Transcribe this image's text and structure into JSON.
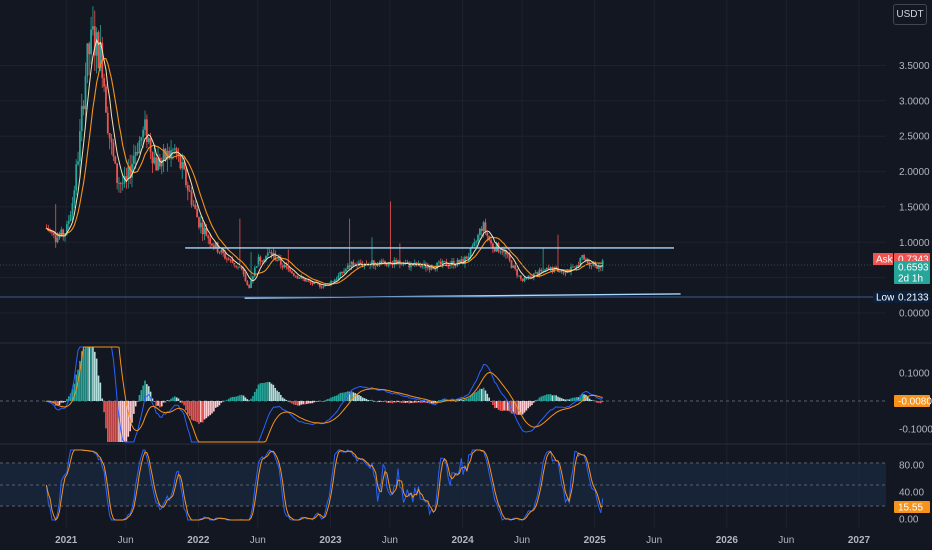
{
  "unit_label": "USDT",
  "colors": {
    "background": "#131722",
    "grid": "#1e222d",
    "up": "#26a69a",
    "down": "#ef5350",
    "ma_fast": "#f5e4b8",
    "ma_slow": "#f7931a",
    "channel": "#a8d8ff",
    "macd_line": "#2962ff",
    "signal_line": "#f7931a",
    "stoch_k": "#2962ff",
    "stoch_d": "#f7931a"
  },
  "chart_data": [
    {
      "type": "candlestick",
      "panel": "price",
      "y_ticks": [
        "3.5000",
        "3.0000",
        "2.5000",
        "2.0000",
        "1.5000",
        "1.0000",
        "0.5000",
        "0.0000"
      ],
      "ylim": [
        0,
        4.2
      ],
      "x_ticks": [
        "2021",
        "Jun",
        "2022",
        "Jun",
        "2023",
        "Jun",
        "2024",
        "Jun",
        "2025",
        "Jun",
        "2026",
        "Jun",
        "2027"
      ],
      "x_tick_years": [
        2021.0,
        2021.45,
        2022.0,
        2022.45,
        2023.0,
        2023.45,
        2024.0,
        2024.45,
        2025.0,
        2025.45,
        2026.0,
        2026.45,
        2027.0
      ],
      "xlim": [
        2020.65,
        2027.25
      ],
      "series_path": [
        [
          2020.85,
          1.2
        ],
        [
          2020.92,
          1.05
        ],
        [
          2021.0,
          1.15
        ],
        [
          2021.05,
          1.6
        ],
        [
          2021.1,
          2.4
        ],
        [
          2021.15,
          3.5
        ],
        [
          2021.2,
          3.9
        ],
        [
          2021.27,
          3.6
        ],
        [
          2021.32,
          2.6
        ],
        [
          2021.38,
          1.9
        ],
        [
          2021.45,
          1.8
        ],
        [
          2021.52,
          2.3
        ],
        [
          2021.6,
          2.6
        ],
        [
          2021.68,
          2.1
        ],
        [
          2021.75,
          2.2
        ],
        [
          2021.82,
          2.3
        ],
        [
          2021.88,
          2.0
        ],
        [
          2021.95,
          1.6
        ],
        [
          2022.0,
          1.3
        ],
        [
          2022.1,
          1.0
        ],
        [
          2022.2,
          0.8
        ],
        [
          2022.32,
          0.62
        ],
        [
          2022.38,
          0.35
        ],
        [
          2022.45,
          0.75
        ],
        [
          2022.55,
          0.85
        ],
        [
          2022.65,
          0.65
        ],
        [
          2022.75,
          0.52
        ],
        [
          2022.85,
          0.42
        ],
        [
          2022.95,
          0.38
        ],
        [
          2023.05,
          0.5
        ],
        [
          2023.15,
          0.68
        ],
        [
          2023.3,
          0.7
        ],
        [
          2023.45,
          0.72
        ],
        [
          2023.6,
          0.68
        ],
        [
          2023.75,
          0.66
        ],
        [
          2023.9,
          0.7
        ],
        [
          2024.0,
          0.72
        ],
        [
          2024.08,
          0.9
        ],
        [
          2024.15,
          1.25
        ],
        [
          2024.22,
          0.95
        ],
        [
          2024.3,
          0.9
        ],
        [
          2024.38,
          0.65
        ],
        [
          2024.45,
          0.45
        ],
        [
          2024.55,
          0.55
        ],
        [
          2024.65,
          0.62
        ],
        [
          2024.75,
          0.6
        ],
        [
          2024.85,
          0.62
        ],
        [
          2024.9,
          0.78
        ],
        [
          2024.95,
          0.72
        ],
        [
          2025.02,
          0.66
        ],
        [
          2025.06,
          0.7
        ]
      ],
      "channel_top": {
        "from": [
          2021.9,
          0.92
        ],
        "to": [
          2025.6,
          0.92
        ]
      },
      "channel_bottom": {
        "from": [
          2022.35,
          0.21
        ],
        "to": [
          2025.65,
          0.27
        ]
      },
      "tags": [
        {
          "label": "Ask",
          "value": "0.7343",
          "color": "#ef5350"
        },
        {
          "label": "",
          "value": "0.6593",
          "color": "#26a69a"
        },
        {
          "label": "",
          "value": "2d 1h",
          "color": "#26a69a"
        },
        {
          "label": "Low",
          "value": "0.2133",
          "color": "#0b1e3a"
        }
      ]
    },
    {
      "type": "macd",
      "panel": "macd",
      "y_ticks": [
        "0.1000",
        "-0.1000"
      ],
      "current_tag": "-0.0080"
    },
    {
      "type": "stochastic",
      "panel": "stoch",
      "y_ticks": [
        "80.00",
        "40.00",
        "0.00"
      ],
      "ylim": [
        0,
        100
      ],
      "current_tag": "15.55"
    }
  ]
}
